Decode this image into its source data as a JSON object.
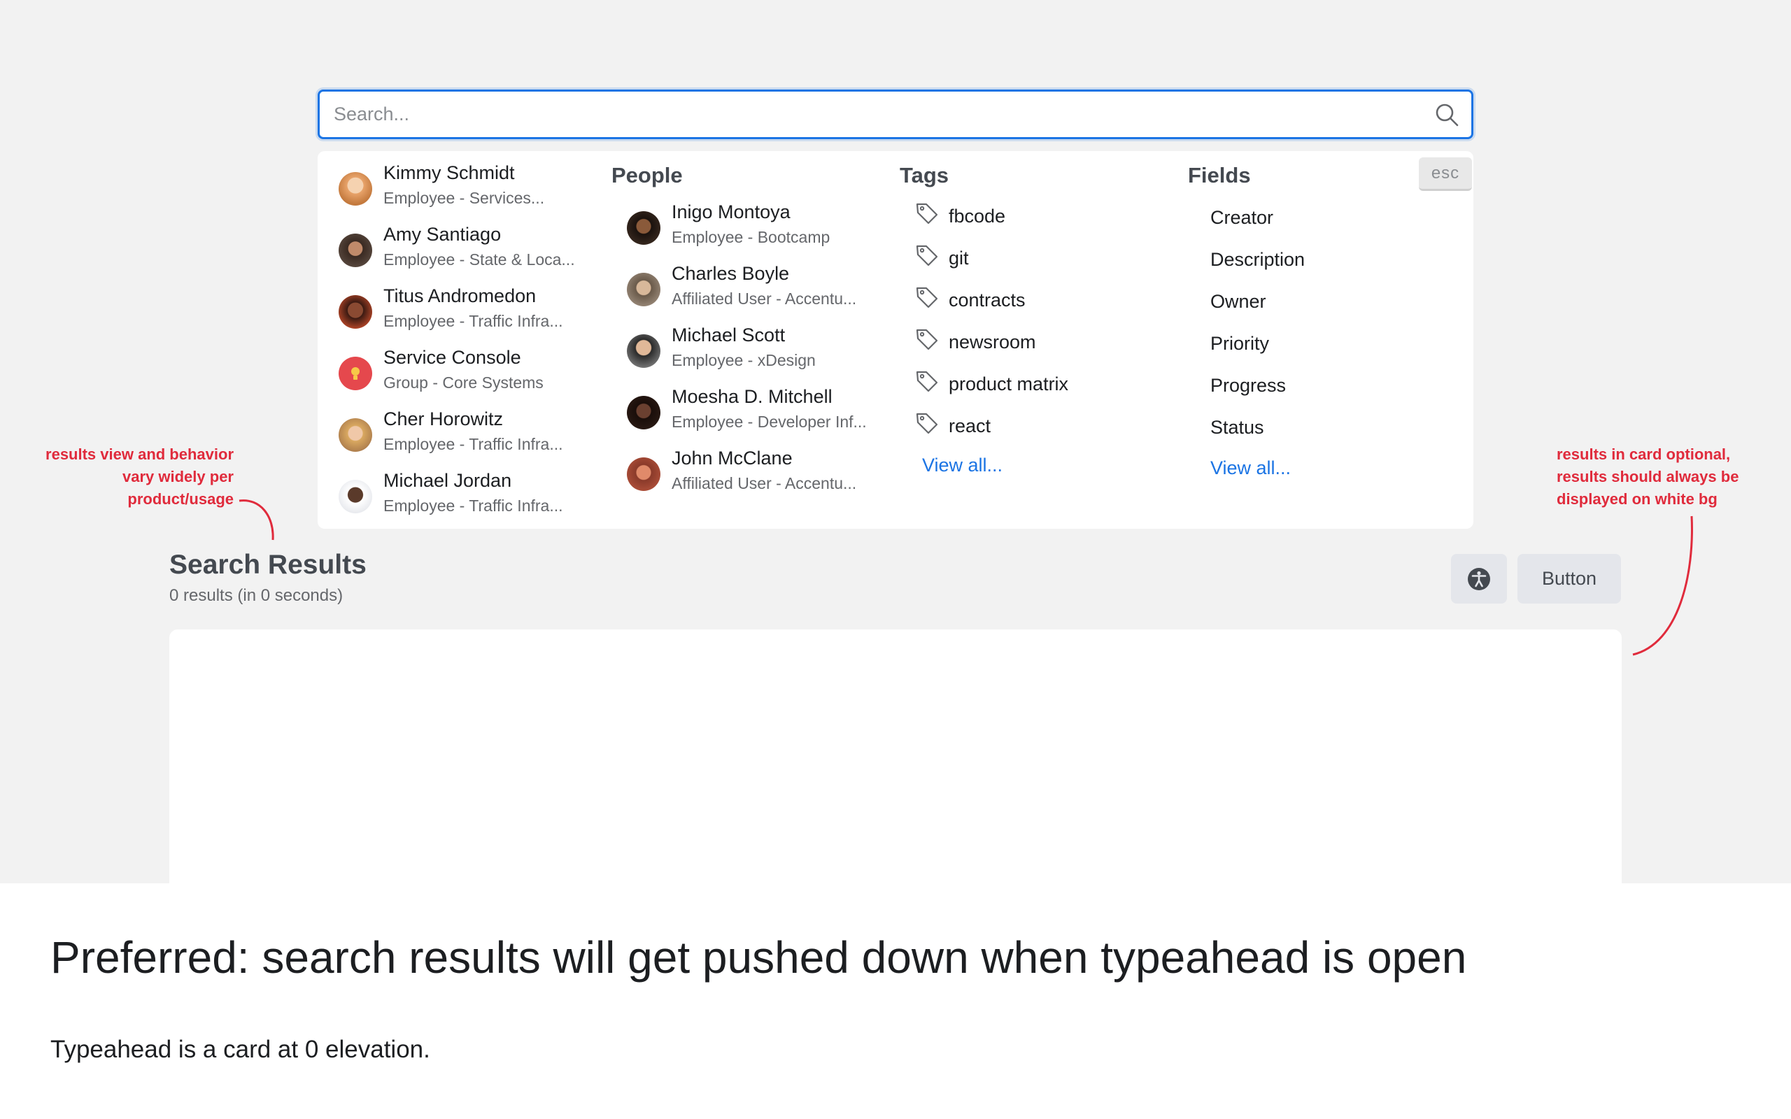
{
  "search": {
    "placeholder": "Search..."
  },
  "typeahead": {
    "esc_label": "esc",
    "recent": [
      {
        "name": "Kimmy Schmidt",
        "sub": "Employee - Services...",
        "avatar": "#e8a36a"
      },
      {
        "name": "Amy Santiago",
        "sub": "Employee - State & Loca...",
        "avatar": "#4a3a33"
      },
      {
        "name": "Titus Andromedon",
        "sub": "Employee - Traffic Infra...",
        "avatar": "#6b3a2a"
      },
      {
        "name": "Service Console",
        "sub": "Group - Core Systems",
        "avatar": "#e5484d"
      },
      {
        "name": "Cher Horowitz",
        "sub": "Employee - Traffic Infra...",
        "avatar": "#d9b38c"
      },
      {
        "name": "Michael Jordan",
        "sub": "Employee - Traffic Infra...",
        "avatar": "#3b2a22"
      }
    ],
    "people_title": "People",
    "people": [
      {
        "name": "Inigo Montoya",
        "sub": "Employee - Bootcamp",
        "avatar": "#3a2a20"
      },
      {
        "name": "Charles Boyle",
        "sub": "Affiliated User - Accentu...",
        "avatar": "#8a7a6a"
      },
      {
        "name": "Michael Scott",
        "sub": "Employee - xDesign",
        "avatar": "#5a5a5a"
      },
      {
        "name": "Moesha D. Mitchell",
        "sub": "Employee - Developer Inf...",
        "avatar": "#2a1a14"
      },
      {
        "name": "John McClane",
        "sub": "Affiliated User - Accentu...",
        "avatar": "#b0503a"
      }
    ],
    "tags_title": "Tags",
    "tags": [
      "fbcode",
      "git",
      "contracts",
      "newsroom",
      "product matrix",
      "react"
    ],
    "tags_view_all": "View all...",
    "fields_title": "Fields",
    "fields": [
      "Creator",
      "Description",
      "Owner",
      "Priority",
      "Progress",
      "Status"
    ],
    "fields_view_all": "View all..."
  },
  "results": {
    "title": "Search Results",
    "count": "0 results (in 0 seconds)",
    "button_label": "Button"
  },
  "annotations": {
    "left": "results view and behavior vary widely per product/usage",
    "right": "results in card optional, results should always be displayed on white bg"
  },
  "footer": {
    "headline": "Preferred: search results will get pushed down when typeahead is open",
    "caption": "Typeahead is a card at 0 elevation."
  },
  "colors": {
    "accent": "#1b74e4",
    "annotation": "#e02b3c",
    "canvas": "#f2f2f2"
  }
}
